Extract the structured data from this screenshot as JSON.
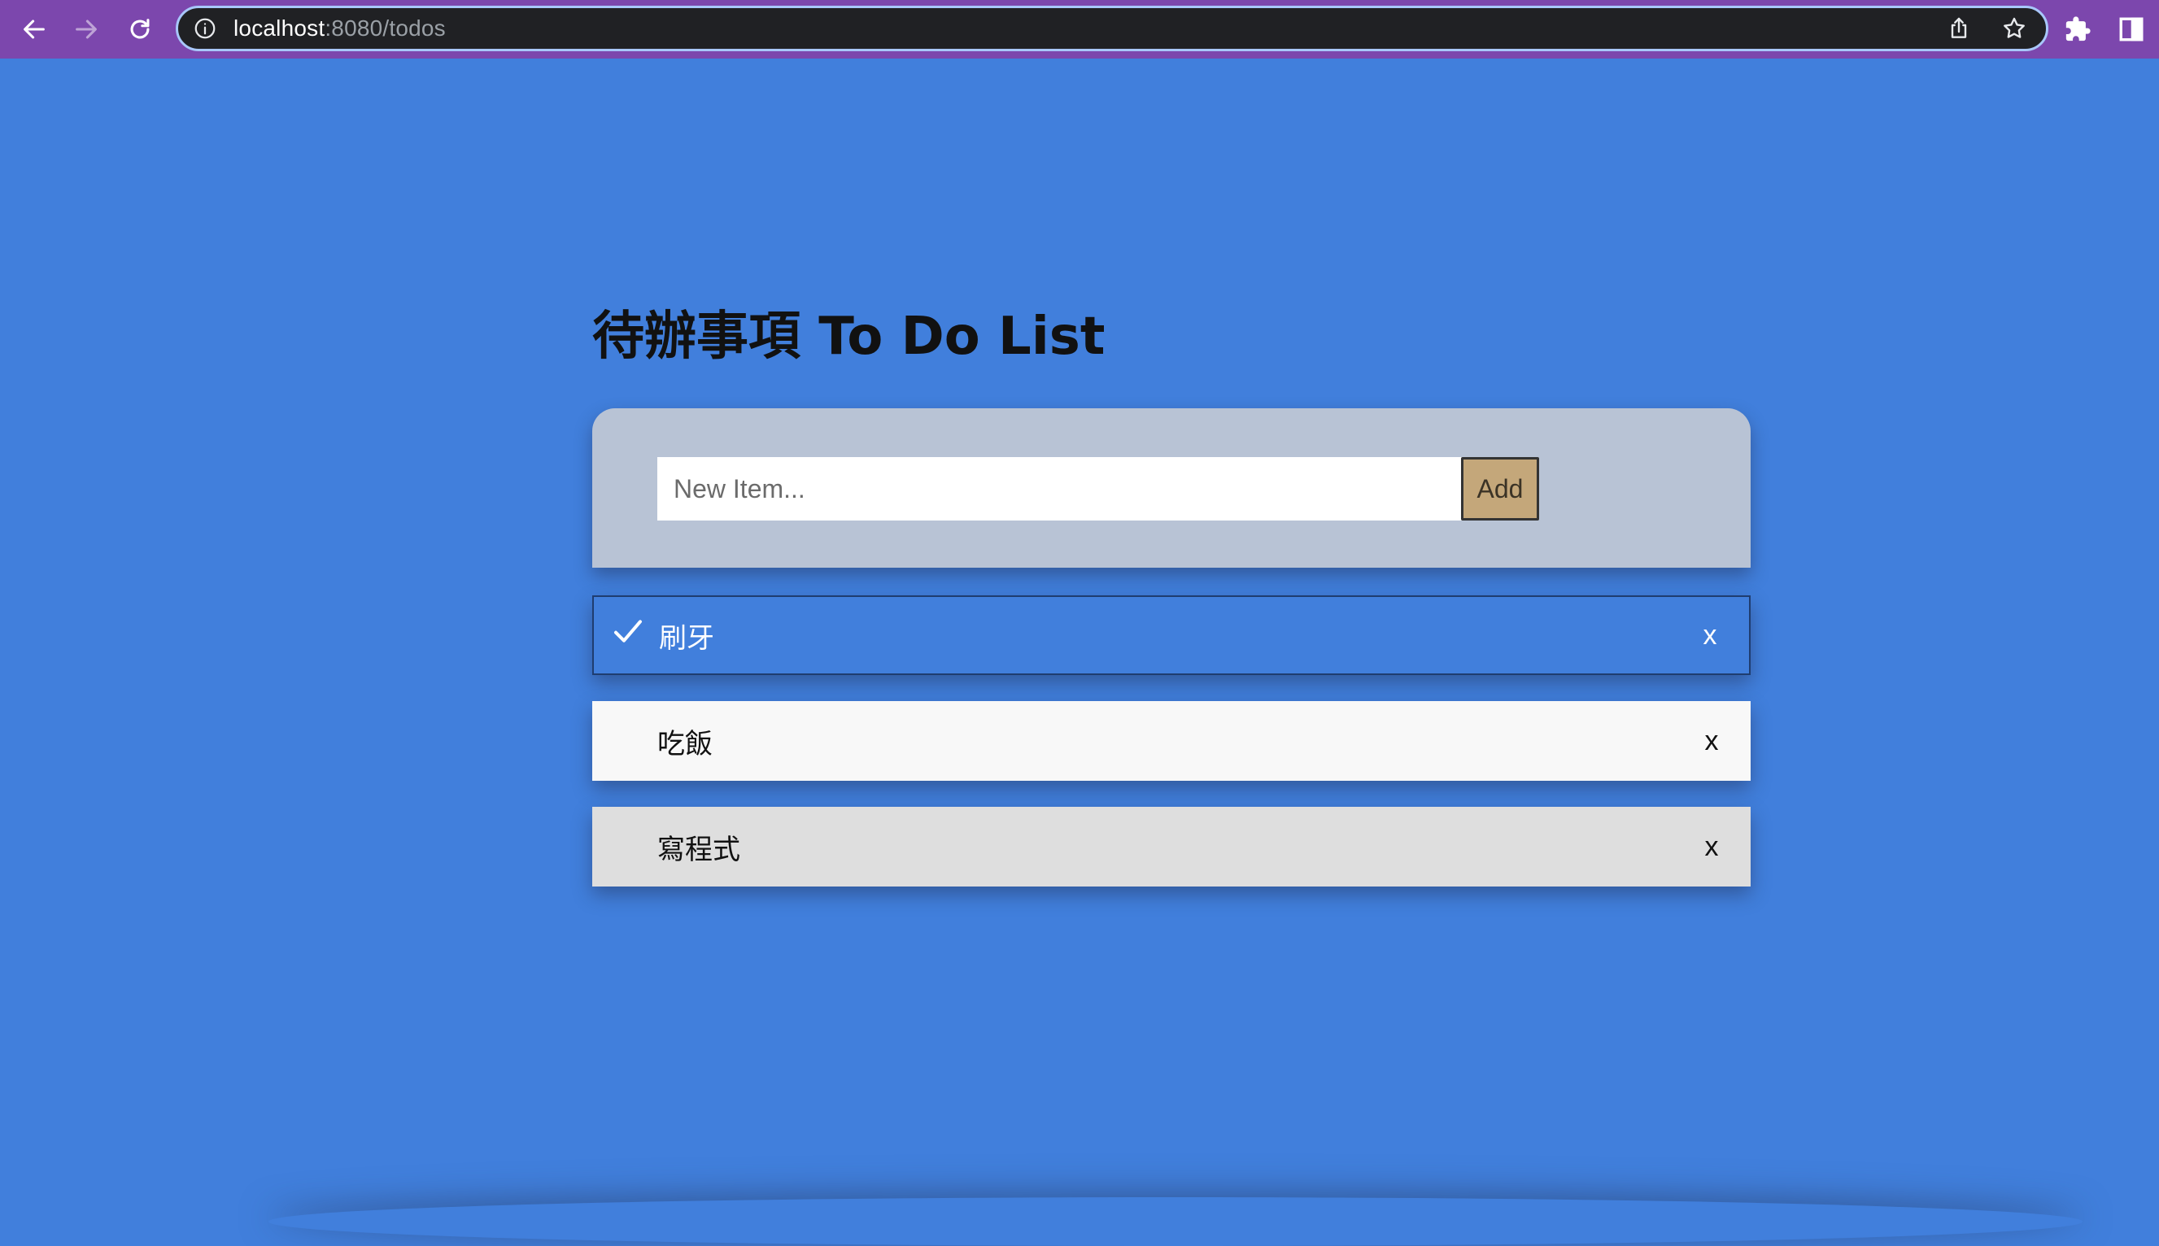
{
  "browser": {
    "url_host": "localhost",
    "url_rest": ":8080/todos"
  },
  "page": {
    "title": "待辦事項 To Do List",
    "input_placeholder": "New Item...",
    "add_label": "Add"
  },
  "todos": [
    {
      "label": "刷牙",
      "checked": true,
      "close_label": "x"
    },
    {
      "label": "吃飯",
      "checked": false,
      "close_label": "x"
    },
    {
      "label": "寫程式",
      "checked": false,
      "close_label": "x"
    }
  ]
}
